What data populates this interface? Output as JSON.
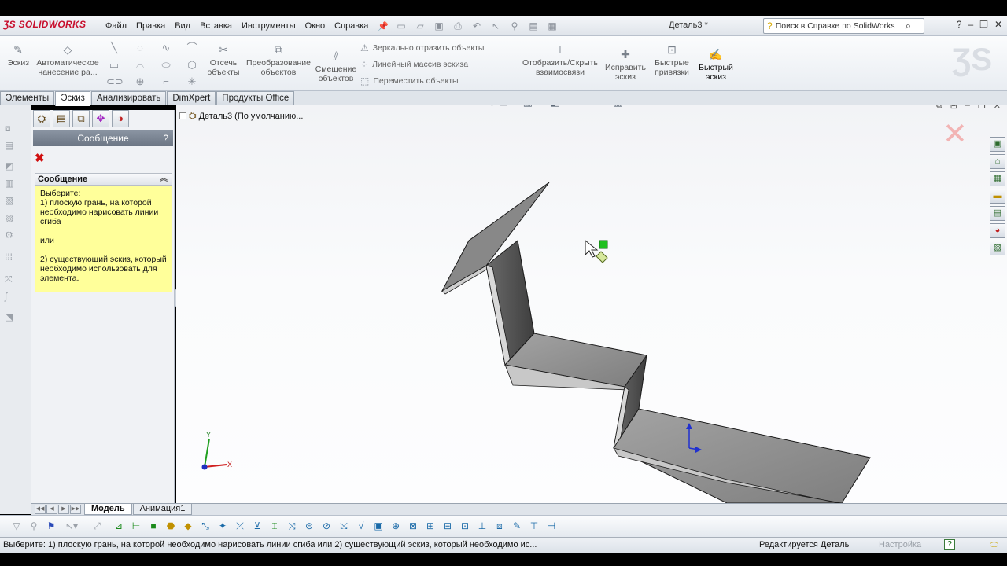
{
  "app": {
    "logo": "SOLIDWORKS",
    "document_title": "Деталь3 *",
    "search_placeholder": "Поиск в Справке по SolidWorks",
    "help_symbol": "?"
  },
  "menu": [
    "Файл",
    "Правка",
    "Вид",
    "Вставка",
    "Инструменты",
    "Окно",
    "Справка"
  ],
  "commands": {
    "sketch": "Эскиз",
    "smart_dim_line1": "Автоматическое",
    "smart_dim_line2": "нанесение ра...",
    "trim_line1": "Отсечь",
    "trim_line2": "объекты",
    "convert_line1": "Преобразование",
    "convert_line2": "объектов",
    "offset_line1": "Смещение",
    "offset_line2": "объектов",
    "mirror": "Зеркально отразить объекты",
    "linear_pattern": "Линейный массив эскиза",
    "move": "Переместить объекты",
    "relations_line1": "Отобразить/Скрыть",
    "relations_line2": "взаимосвязи",
    "repair_line1": "Исправить",
    "repair_line2": "эскиз",
    "snaps_line1": "Быстрые",
    "snaps_line2": "привязки",
    "rapid_line1": "Быстрый",
    "rapid_line2": "эскиз"
  },
  "tabs": [
    {
      "label": "Элементы"
    },
    {
      "label": "Эскиз"
    },
    {
      "label": "Анализировать"
    },
    {
      "label": "DimXpert"
    },
    {
      "label": "Продукты Office"
    }
  ],
  "property_manager": {
    "title": "Сообщение",
    "help": "?",
    "message_header": "Сообщение",
    "message_text": "Выберите:\n 1) плоскую грань, на которой необходимо нарисовать линии сгиба\n\nили\n\n2) существующий эскиз, который необходимо использовать для элемента."
  },
  "feature_tree": {
    "root_label": "Деталь3  (По умолчанию..."
  },
  "axes": {
    "x": "X",
    "y": "Y"
  },
  "bottom_tabs": [
    {
      "label": "Модель"
    },
    {
      "label": "Анимация1"
    }
  ],
  "status_bar": {
    "message": "Выберите: 1) плоскую грань, на которой необходимо нарисовать линии сгиба   или  2) существующий эскиз, который необходимо ис...",
    "editing": "Редактируется Деталь",
    "configure": "Настройка"
  },
  "colors": {
    "part_fill": "#8e8e8e",
    "part_edge": "#1a1a1a",
    "accent_red": "#c8102e",
    "message_bg": "#ffff9a"
  }
}
